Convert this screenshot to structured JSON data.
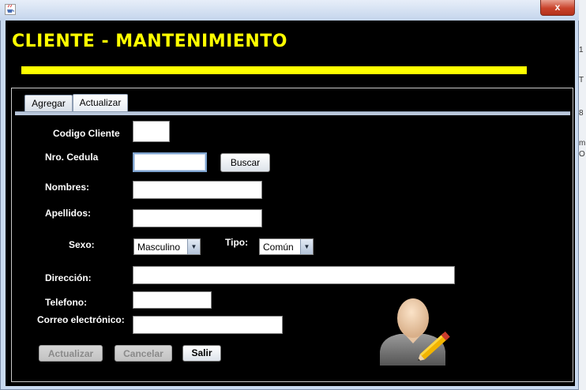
{
  "window": {
    "title": "",
    "close_label": "x",
    "icon": "java-cup-icon"
  },
  "background_app": {
    "chars": [
      "1",
      "T",
      "8",
      "m",
      "O"
    ]
  },
  "header": {
    "title": "CLIENTE - MANTENIMIENTO",
    "accent_color": "#ffff00"
  },
  "tabs": [
    {
      "label": "Agregar",
      "selected": false
    },
    {
      "label": "Actualizar",
      "selected": true
    }
  ],
  "form": {
    "codigo_label": "Codigo Cliente",
    "codigo_value": "",
    "cedula_label": "Nro. Cedula",
    "cedula_value": "",
    "buscar_label": "Buscar",
    "nombres_label": "Nombres:",
    "nombres_value": "",
    "apellidos_label": "Apellidos:",
    "apellidos_value": "",
    "sexo_label": "Sexo:",
    "sexo_value": "Masculino",
    "tipo_label": "Tipo:",
    "tipo_value": "Común",
    "direccion_label": "Dirección:",
    "direccion_value": "",
    "telefono_label": "Telefono:",
    "telefono_value": "",
    "correo_label": "Correo electrónico:",
    "correo_value": ""
  },
  "actions": {
    "actualizar_label": "Actualizar",
    "cancelar_label": "Cancelar",
    "salir_label": "Salir"
  },
  "icons": {
    "dropdown": "chevron-down-icon",
    "user_edit": "user-edit-icon"
  }
}
